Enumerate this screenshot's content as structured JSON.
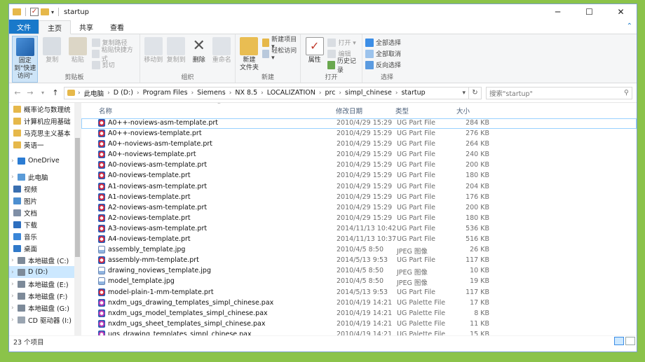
{
  "window": {
    "title": "startup",
    "controls": {
      "minimize": "─",
      "maximize": "☐",
      "close": "✕"
    }
  },
  "ribbon_tabs": [
    "文件",
    "主页",
    "共享",
    "查看"
  ],
  "ribbon": {
    "clipboard": {
      "pin": "固定到\"快速访问\"",
      "copy": "复制",
      "paste": "粘贴",
      "copy_path": "复制路径",
      "paste_shortcut": "粘贴快捷方式",
      "cut": "剪切",
      "label": "剪贴板"
    },
    "organize": {
      "move_to": "移动到",
      "copy_to": "复制到",
      "delete": "删除",
      "rename": "重命名",
      "label": "组织"
    },
    "new": {
      "new_folder": "新建\n文件夹",
      "new_item": "新建项目 ▾",
      "easy_access": "轻松访问 ▾",
      "label": "新建"
    },
    "open": {
      "properties": "属性",
      "open": "打开 ▾",
      "edit": "编辑",
      "history": "历史记录",
      "label": "打开"
    },
    "select": {
      "select_all": "全部选择",
      "select_none": "全部取消",
      "invert": "反向选择",
      "label": "选择"
    }
  },
  "address": {
    "crumbs": [
      "此电脑",
      "D (D:)",
      "Program Files",
      "Siemens",
      "NX 8.5",
      "LOCALIZATION",
      "prc",
      "simpl_chinese",
      "startup"
    ],
    "search_placeholder": "搜索\"startup\""
  },
  "sidebar": [
    {
      "label": "概率论与数理统",
      "icon": "folder"
    },
    {
      "label": "计算机应用基础",
      "icon": "folder"
    },
    {
      "label": "马克思主义基本",
      "icon": "folder"
    },
    {
      "label": "英语一",
      "icon": "folder"
    },
    {
      "label": "OneDrive",
      "icon": "cloud"
    },
    {
      "label": "此电脑",
      "icon": "pc"
    },
    {
      "label": "视频",
      "icon": "video"
    },
    {
      "label": "图片",
      "icon": "picture"
    },
    {
      "label": "文档",
      "icon": "document"
    },
    {
      "label": "下载",
      "icon": "download"
    },
    {
      "label": "音乐",
      "icon": "music"
    },
    {
      "label": "桌面",
      "icon": "desktop"
    },
    {
      "label": "本地磁盘 (C:)",
      "icon": "drive"
    },
    {
      "label": "D (D:)",
      "icon": "drive",
      "selected": true
    },
    {
      "label": "本地磁盘 (E:)",
      "icon": "drive"
    },
    {
      "label": "本地磁盘 (F:)",
      "icon": "drive"
    },
    {
      "label": "本地磁盘 (G:)",
      "icon": "drive"
    },
    {
      "label": "CD 驱动器 (I:)",
      "icon": "cd"
    }
  ],
  "columns": {
    "name": "名称",
    "date": "修改日期",
    "type": "类型",
    "size": "大小"
  },
  "files": [
    {
      "name": "A0++-noviews-asm-template.prt",
      "date": "2010/4/29 15:29",
      "type": "UG Part File",
      "size": "284 KB",
      "kind": "prt",
      "selected": true
    },
    {
      "name": "A0++-noviews-template.prt",
      "date": "2010/4/29 15:29",
      "type": "UG Part File",
      "size": "276 KB",
      "kind": "prt"
    },
    {
      "name": "A0+-noviews-asm-template.prt",
      "date": "2010/4/29 15:29",
      "type": "UG Part File",
      "size": "264 KB",
      "kind": "prt"
    },
    {
      "name": "A0+-noviews-template.prt",
      "date": "2010/4/29 15:29",
      "type": "UG Part File",
      "size": "240 KB",
      "kind": "prt"
    },
    {
      "name": "A0-noviews-asm-template.prt",
      "date": "2010/4/29 15:29",
      "type": "UG Part File",
      "size": "200 KB",
      "kind": "prt"
    },
    {
      "name": "A0-noviews-template.prt",
      "date": "2010/4/29 15:29",
      "type": "UG Part File",
      "size": "180 KB",
      "kind": "prt"
    },
    {
      "name": "A1-noviews-asm-template.prt",
      "date": "2010/4/29 15:29",
      "type": "UG Part File",
      "size": "204 KB",
      "kind": "prt"
    },
    {
      "name": "A1-noviews-template.prt",
      "date": "2010/4/29 15:29",
      "type": "UG Part File",
      "size": "176 KB",
      "kind": "prt"
    },
    {
      "name": "A2-noviews-asm-template.prt",
      "date": "2010/4/29 15:29",
      "type": "UG Part File",
      "size": "200 KB",
      "kind": "prt"
    },
    {
      "name": "A2-noviews-template.prt",
      "date": "2010/4/29 15:29",
      "type": "UG Part File",
      "size": "180 KB",
      "kind": "prt"
    },
    {
      "name": "A3-noviews-asm-template.prt",
      "date": "2014/11/13 10:42",
      "type": "UG Part File",
      "size": "536 KB",
      "kind": "prt"
    },
    {
      "name": "A4-noviews-template.prt",
      "date": "2014/11/13 10:37",
      "type": "UG Part File",
      "size": "516 KB",
      "kind": "prt"
    },
    {
      "name": "assembly_template.jpg",
      "date": "2010/4/5 8:50",
      "type": "JPEG 图像",
      "size": "26 KB",
      "kind": "jpg"
    },
    {
      "name": "assembly-mm-template.prt",
      "date": "2014/5/13 9:53",
      "type": "UG Part File",
      "size": "117 KB",
      "kind": "prt"
    },
    {
      "name": "drawing_noviews_template.jpg",
      "date": "2010/4/5 8:50",
      "type": "JPEG 图像",
      "size": "10 KB",
      "kind": "jpg"
    },
    {
      "name": "model_template.jpg",
      "date": "2010/4/5 8:50",
      "type": "JPEG 图像",
      "size": "19 KB",
      "kind": "jpg"
    },
    {
      "name": "model-plain-1-mm-template.prt",
      "date": "2014/5/13 9:53",
      "type": "UG Part File",
      "size": "117 KB",
      "kind": "prt"
    },
    {
      "name": "nxdm_ugs_drawing_templates_simpl_chinese.pax",
      "date": "2010/4/19 14:21",
      "type": "UG Palette File",
      "size": "17 KB",
      "kind": "pax"
    },
    {
      "name": "nxdm_ugs_model_templates_simpl_chinese.pax",
      "date": "2010/4/19 14:21",
      "type": "UG Palette File",
      "size": "8 KB",
      "kind": "pax"
    },
    {
      "name": "nxdm_ugs_sheet_templates_simpl_chinese.pax",
      "date": "2010/4/19 14:21",
      "type": "UG Palette File",
      "size": "11 KB",
      "kind": "pax"
    },
    {
      "name": "ugs_drawing_templates_simpl_chinese.pax",
      "date": "2010/4/19 14:21",
      "type": "UG Palette File",
      "size": "15 KB",
      "kind": "pax"
    }
  ],
  "status": {
    "count": "23 个项目"
  }
}
